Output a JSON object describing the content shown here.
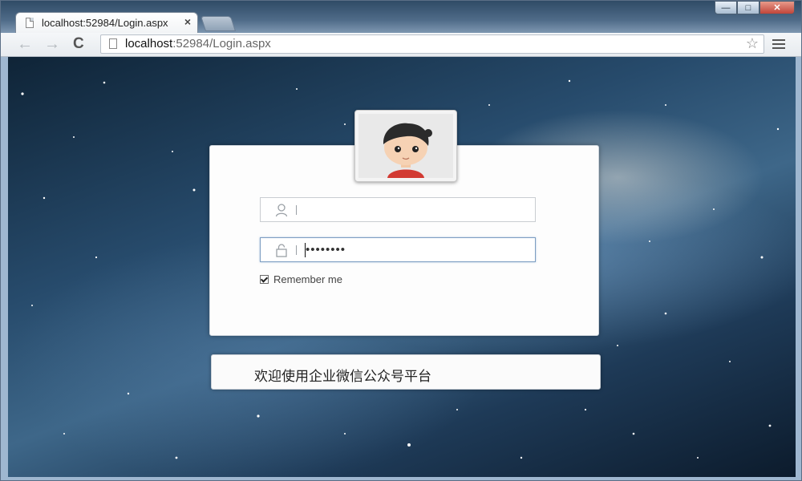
{
  "browser": {
    "tab_title": "localhost:52984/Login.aspx",
    "tab_close": "×",
    "url_host": "localhost",
    "url_rest": ":52984/Login.aspx",
    "window_controls": {
      "minimize": "—",
      "maximize": "□",
      "close": "✕"
    },
    "nav": {
      "back": "←",
      "forward": "→",
      "reload": "C"
    },
    "bookmark_star": "☆"
  },
  "login": {
    "username": {
      "value": "",
      "placeholder": ""
    },
    "password": {
      "value": "••••••••"
    },
    "remember_checked": true,
    "remember_label": "Remember me",
    "icons": {
      "username": "user-icon",
      "password": "lock-icon",
      "avatar": "cartoon-boy-avatar"
    }
  },
  "welcome": {
    "text": "欢迎使用企业微信公众号平台"
  },
  "colors": {
    "field_focus_border": "#7d9ec2",
    "card_bg": "#fdfdfd",
    "avatar_shirt": "#d23a32"
  }
}
